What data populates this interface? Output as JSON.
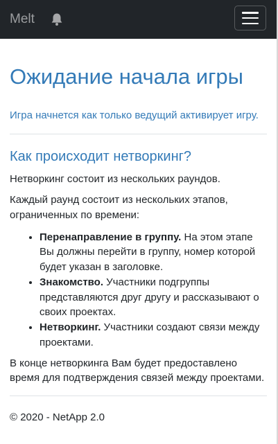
{
  "navbar": {
    "brand": "Melt",
    "bell_icon": "bell-icon",
    "menu_icon": "hamburger-menu-icon"
  },
  "main": {
    "title": "Ожидание начала игры",
    "lead": "Игра начнется как только ведущий активирует игру.",
    "section_title": "Как происходит нетворкинг?",
    "para1": "Нетворкинг состоит из нескольких раундов.",
    "para2": "Каждый раунд состоит из нескольких этапов, ограниченных по времени:",
    "steps": [
      {
        "title": "Перенаправление в группу.",
        "text": " На этом этапе Вы должны перейти в группу, номер которой будет указан в заголовке."
      },
      {
        "title": "Знакомство.",
        "text": " Участники подгруппы представляются друг другу и рассказывают о своих проектах."
      },
      {
        "title": "Нетворкинг.",
        "text": " Участники создают связи между проектами."
      }
    ],
    "para3": "В конце нетворкинга Вам будет предоставлено время для подтверждения связей между проектами."
  },
  "footer": {
    "text": "© 2020 - NetApp 2.0"
  },
  "colors": {
    "navbar_bg": "#212529",
    "accent": "#337ab7"
  }
}
